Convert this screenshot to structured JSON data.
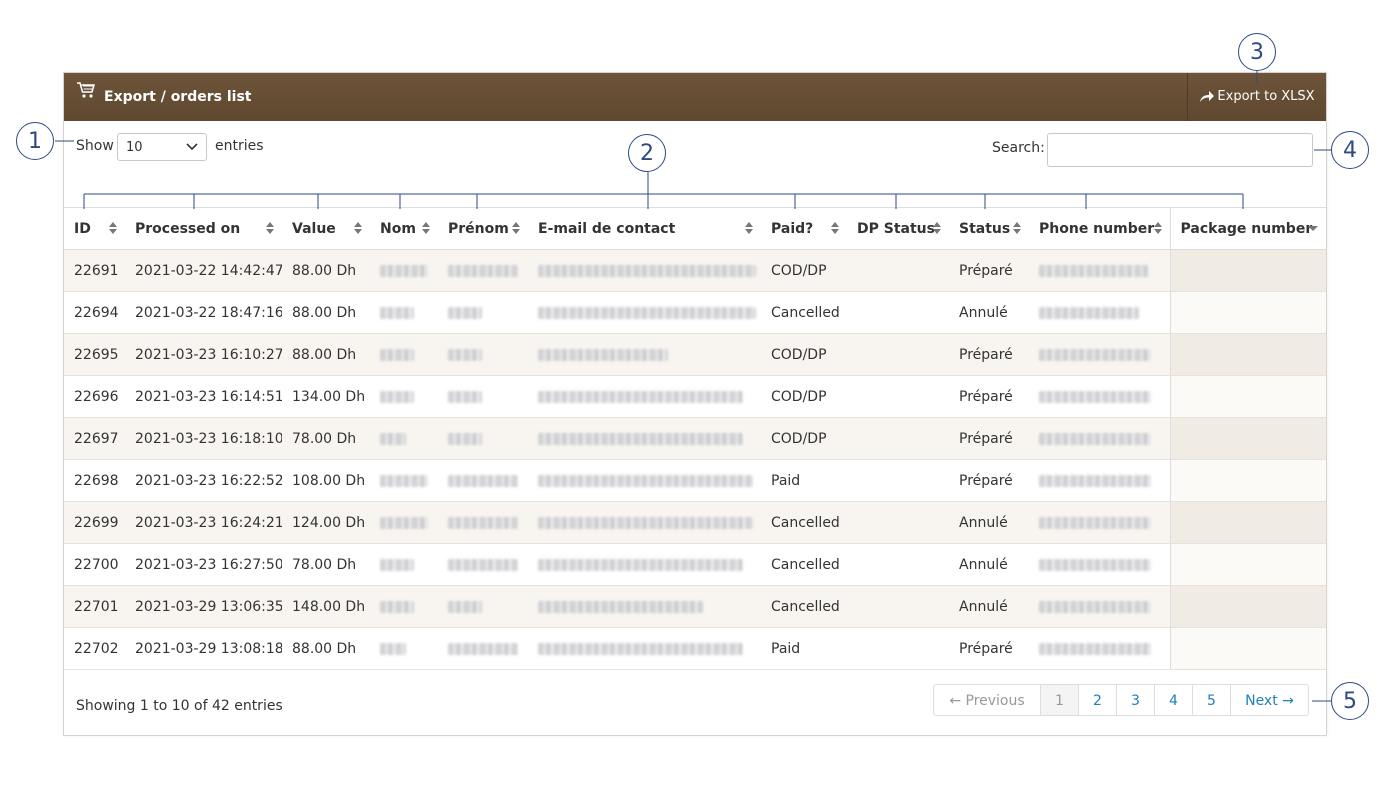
{
  "panel": {
    "title": "Export / orders list",
    "cart_icon": "cart-icon",
    "export_label": "Export to XLSX",
    "export_icon": "share-arrow-icon"
  },
  "controls": {
    "show_label": "Show",
    "entries_label": "entries",
    "page_length": "10",
    "search_label": "Search:",
    "search_value": ""
  },
  "table": {
    "columns": [
      "ID",
      "Processed on",
      "Value",
      "Nom",
      "Prénom",
      "E-mail de contact",
      "Paid?",
      "DP Status",
      "Status",
      "Phone number",
      "Package number"
    ],
    "rows": [
      {
        "id": "22691",
        "processed": "2021-03-22 14:42:47",
        "value": "88.00 Dh",
        "paid": "COD/DP",
        "dp_status": "",
        "status": "Préparé",
        "package": ""
      },
      {
        "id": "22694",
        "processed": "2021-03-22 18:47:16",
        "value": "88.00 Dh",
        "paid": "Cancelled",
        "dp_status": "",
        "status": "Annulé",
        "package": ""
      },
      {
        "id": "22695",
        "processed": "2021-03-23 16:10:27",
        "value": "88.00 Dh",
        "paid": "COD/DP",
        "dp_status": "",
        "status": "Préparé",
        "package": ""
      },
      {
        "id": "22696",
        "processed": "2021-03-23 16:14:51",
        "value": "134.00 Dh",
        "paid": "COD/DP",
        "dp_status": "",
        "status": "Préparé",
        "package": ""
      },
      {
        "id": "22697",
        "processed": "2021-03-23 16:18:10",
        "value": "78.00 Dh",
        "paid": "COD/DP",
        "dp_status": "",
        "status": "Préparé",
        "package": ""
      },
      {
        "id": "22698",
        "processed": "2021-03-23 16:22:52",
        "value": "108.00 Dh",
        "paid": "Paid",
        "dp_status": "",
        "status": "Préparé",
        "package": ""
      },
      {
        "id": "22699",
        "processed": "2021-03-23 16:24:21",
        "value": "124.00 Dh",
        "paid": "Cancelled",
        "dp_status": "",
        "status": "Annulé",
        "package": ""
      },
      {
        "id": "22700",
        "processed": "2021-03-23 16:27:50",
        "value": "78.00 Dh",
        "paid": "Cancelled",
        "dp_status": "",
        "status": "Annulé",
        "package": ""
      },
      {
        "id": "22701",
        "processed": "2021-03-29 13:06:35",
        "value": "148.00 Dh",
        "paid": "Cancelled",
        "dp_status": "",
        "status": "Annulé",
        "package": ""
      },
      {
        "id": "22702",
        "processed": "2021-03-29 13:08:18",
        "value": "88.00 Dh",
        "paid": "Paid",
        "dp_status": "",
        "status": "Préparé",
        "package": ""
      }
    ]
  },
  "footer": {
    "info": "Showing 1 to 10 of 42 entries",
    "prev_label": "← Previous",
    "next_label": "Next →",
    "pages": [
      "1",
      "2",
      "3",
      "4",
      "5"
    ],
    "current_page": "1"
  },
  "callouts": [
    "1",
    "2",
    "3",
    "4",
    "5"
  ],
  "colors": {
    "header_brown": "#6b5239",
    "odd_row": "#f8f5f0",
    "link_blue": "#1f7fbf",
    "callout_blue": "#2e4a86"
  }
}
